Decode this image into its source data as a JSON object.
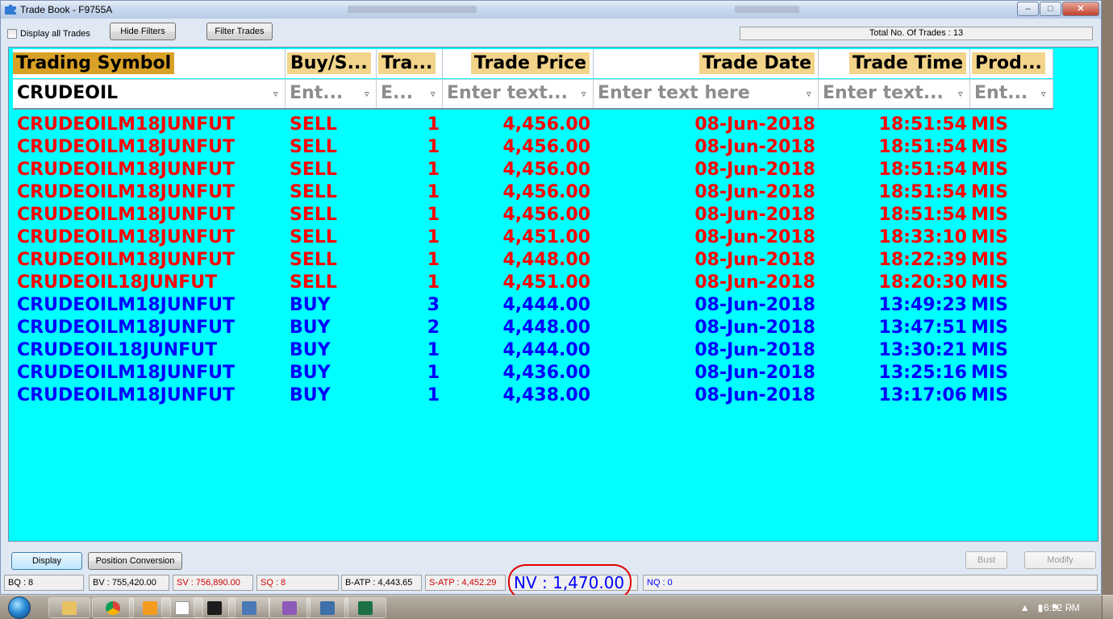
{
  "window": {
    "title": "Trade Book - F9755A"
  },
  "toolbar": {
    "display_all_label": "Display all Trades",
    "hide_filters_label": "Hide Filters",
    "filter_trades_label": "Filter Trades",
    "total_trades_text": "Total No. Of Trades : 13"
  },
  "table": {
    "headers": [
      "Trading Symbol",
      "Buy/S...",
      "Tra...",
      "Trade Price",
      "Trade Date",
      "Trade Time",
      "Prod..."
    ],
    "filters": [
      "CRUDEOIL",
      "Ent...",
      "E...",
      "Enter text...",
      "Enter text here",
      "Enter text...",
      "Ent..."
    ],
    "rows": [
      {
        "symbol": "CRUDEOILM18JUNFUT",
        "side": "SELL",
        "qty": "1",
        "price": "4,456.00",
        "date": "08-Jun-2018",
        "time": "18:51:54",
        "product": "MIS"
      },
      {
        "symbol": "CRUDEOILM18JUNFUT",
        "side": "SELL",
        "qty": "1",
        "price": "4,456.00",
        "date": "08-Jun-2018",
        "time": "18:51:54",
        "product": "MIS"
      },
      {
        "symbol": "CRUDEOILM18JUNFUT",
        "side": "SELL",
        "qty": "1",
        "price": "4,456.00",
        "date": "08-Jun-2018",
        "time": "18:51:54",
        "product": "MIS"
      },
      {
        "symbol": "CRUDEOILM18JUNFUT",
        "side": "SELL",
        "qty": "1",
        "price": "4,456.00",
        "date": "08-Jun-2018",
        "time": "18:51:54",
        "product": "MIS"
      },
      {
        "symbol": "CRUDEOILM18JUNFUT",
        "side": "SELL",
        "qty": "1",
        "price": "4,456.00",
        "date": "08-Jun-2018",
        "time": "18:51:54",
        "product": "MIS"
      },
      {
        "symbol": "CRUDEOILM18JUNFUT",
        "side": "SELL",
        "qty": "1",
        "price": "4,451.00",
        "date": "08-Jun-2018",
        "time": "18:33:10",
        "product": "MIS"
      },
      {
        "symbol": "CRUDEOILM18JUNFUT",
        "side": "SELL",
        "qty": "1",
        "price": "4,448.00",
        "date": "08-Jun-2018",
        "time": "18:22:39",
        "product": "MIS"
      },
      {
        "symbol": "CRUDEOIL18JUNFUT",
        "side": "SELL",
        "qty": "1",
        "price": "4,451.00",
        "date": "08-Jun-2018",
        "time": "18:20:30",
        "product": "MIS"
      },
      {
        "symbol": "CRUDEOILM18JUNFUT",
        "side": "BUY",
        "qty": "3",
        "price": "4,444.00",
        "date": "08-Jun-2018",
        "time": "13:49:23",
        "product": "MIS"
      },
      {
        "symbol": "CRUDEOILM18JUNFUT",
        "side": "BUY",
        "qty": "2",
        "price": "4,448.00",
        "date": "08-Jun-2018",
        "time": "13:47:51",
        "product": "MIS"
      },
      {
        "symbol": "CRUDEOIL18JUNFUT",
        "side": "BUY",
        "qty": "1",
        "price": "4,444.00",
        "date": "08-Jun-2018",
        "time": "13:30:21",
        "product": "MIS"
      },
      {
        "symbol": "CRUDEOILM18JUNFUT",
        "side": "BUY",
        "qty": "1",
        "price": "4,436.00",
        "date": "08-Jun-2018",
        "time": "13:25:16",
        "product": "MIS"
      },
      {
        "symbol": "CRUDEOILM18JUNFUT",
        "side": "BUY",
        "qty": "1",
        "price": "4,438.00",
        "date": "08-Jun-2018",
        "time": "13:17:06",
        "product": "MIS"
      }
    ]
  },
  "bottom": {
    "display_label": "Display",
    "position_conversion_label": "Position Conversion",
    "bust_label": "Bust",
    "modify_label": "Modify"
  },
  "status": {
    "bq": "BQ : 8",
    "bv": "BV : 755,420.00",
    "sv": "SV : 756,890.00",
    "sq": "SQ : 8",
    "batp": "B-ATP : 4,443.65",
    "satp": "S-ATP : 4,452.29",
    "nv": "NV : 1,470.00",
    "nq": "NQ : 0"
  },
  "taskbar": {
    "clock": "6:52 PM"
  },
  "colors": {
    "sell": "#ff0000",
    "buy": "#0000ff",
    "grid_bg": "#00ffff",
    "header_highlight": "#f2d48a",
    "symbol_header": "#d9a227"
  }
}
